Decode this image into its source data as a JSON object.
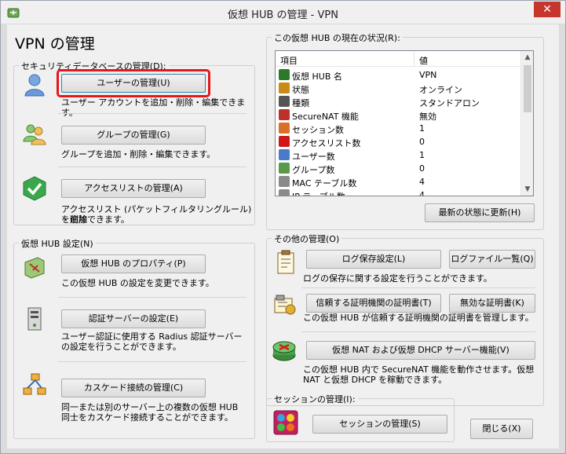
{
  "window": {
    "title": "仮想 HUB の管理 - VPN",
    "close_glyph": "✕"
  },
  "heading": "VPN の管理",
  "security_db": {
    "title": "セキュリティデータベースの管理(D):",
    "items": [
      {
        "button": "ユーザーの管理(U)",
        "desc": "ユーザー アカウントを追加・削除・編集できます。",
        "icon": "user-icon"
      },
      {
        "button": "グループの管理(G)",
        "desc": "グループを追加・削除・編集できます。",
        "icon": "group-icon"
      },
      {
        "button": "アクセスリストの管理(A)",
        "desc_line1": "アクセスリスト (パケットフィルタリングルール) を追加",
        "desc_line2": "・削除できます。",
        "icon": "checkmark-icon"
      }
    ]
  },
  "hub_settings": {
    "title": "仮想 HUB 設定(N)",
    "items": [
      {
        "button": "仮想 HUB のプロパティ(P)",
        "desc": "この仮想 HUB の設定を変更できます。",
        "icon": "hub-properties-icon"
      },
      {
        "button": "認証サーバーの設定(E)",
        "desc_line1": "ユーザー認証に使用する Radius 認証サーバー",
        "desc_line2": "の設定を行うことができます。",
        "icon": "server-icon"
      },
      {
        "button": "カスケード接続の管理(C)",
        "desc_line1": "同一または別のサーバー上の複数の仮想 HUB",
        "desc_line2": "同士をカスケード接続することができます。",
        "icon": "cascade-icon"
      }
    ]
  },
  "status": {
    "title": "この仮想 HUB の現在の状況(R):",
    "columns": [
      "項目",
      "値"
    ],
    "rows": [
      {
        "key": "仮想 HUB 名",
        "value": "VPN",
        "icon": "hub-icon",
        "color": "#2a7a2a"
      },
      {
        "key": "状態",
        "value": "オンライン",
        "icon": "status-icon",
        "color": "#c98a18"
      },
      {
        "key": "種類",
        "value": "スタンドアロン",
        "icon": "server-icon",
        "color": "#555555"
      },
      {
        "key": "SecureNAT 機能",
        "value": "無効",
        "icon": "router-icon",
        "color": "#c0302a"
      },
      {
        "key": "セッション数",
        "value": "1",
        "icon": "session-icon",
        "color": "#d8702a"
      },
      {
        "key": "アクセスリスト数",
        "value": "0",
        "icon": "stop-icon",
        "color": "#d01818"
      },
      {
        "key": "ユーザー数",
        "value": "1",
        "icon": "user-icon",
        "color": "#4a7ac8"
      },
      {
        "key": "グループ数",
        "value": "0",
        "icon": "group-icon",
        "color": "#5a9a4a"
      },
      {
        "key": "MAC テーブル数",
        "value": "4",
        "icon": "gear-icon",
        "color": "#8a8a8a"
      },
      {
        "key": "IP テーブル数",
        "value": "4",
        "icon": "gear-icon",
        "color": "#8a8a8a"
      }
    ],
    "refresh_button": "最新の状態に更新(H)"
  },
  "other": {
    "title": "その他の管理(O)",
    "log": {
      "button": "ログ保存設定(L)",
      "button2": "ログファイル一覧(Q)",
      "desc": "ログの保存に関する設定を行うことができます。"
    },
    "cert": {
      "button": "信頼する証明機関の証明書(T)",
      "button2": "無効な証明書(K)",
      "desc": "この仮想 HUB が信頼する証明機関の証明書を管理します。"
    },
    "nat": {
      "button": "仮想 NAT および仮想 DHCP サーバー機能(V)",
      "desc_line1": "この仮想 HUB 内で SecureNAT 機能を動作させます。仮想",
      "desc_line2": "NAT と仮想 DHCP を稼動できます。"
    }
  },
  "session": {
    "title": "セッションの管理(I):",
    "button": "セッションの管理(S)"
  },
  "close_button": "閉じる(X)"
}
